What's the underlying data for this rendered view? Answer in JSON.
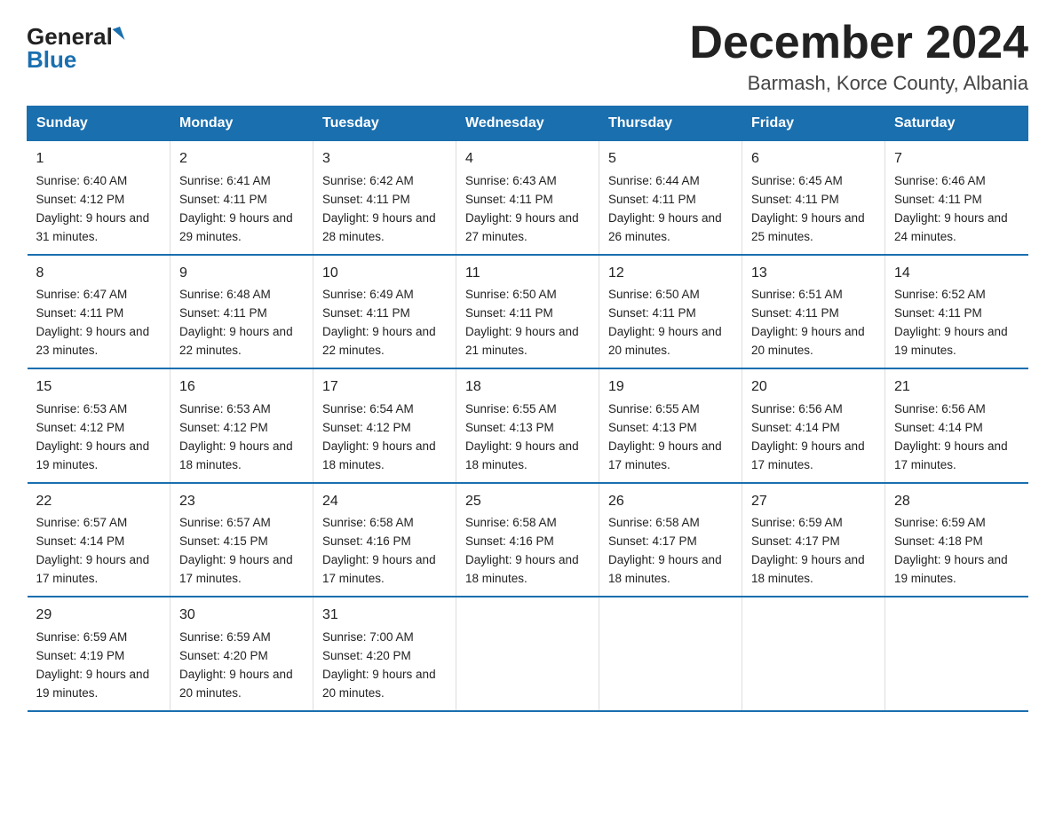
{
  "logo": {
    "general": "General",
    "blue": "Blue"
  },
  "title": "December 2024",
  "subtitle": "Barmash, Korce County, Albania",
  "weekdays": [
    "Sunday",
    "Monday",
    "Tuesday",
    "Wednesday",
    "Thursday",
    "Friday",
    "Saturday"
  ],
  "weeks": [
    [
      {
        "day": "1",
        "sunrise": "6:40 AM",
        "sunset": "4:12 PM",
        "daylight": "9 hours and 31 minutes."
      },
      {
        "day": "2",
        "sunrise": "6:41 AM",
        "sunset": "4:11 PM",
        "daylight": "9 hours and 29 minutes."
      },
      {
        "day": "3",
        "sunrise": "6:42 AM",
        "sunset": "4:11 PM",
        "daylight": "9 hours and 28 minutes."
      },
      {
        "day": "4",
        "sunrise": "6:43 AM",
        "sunset": "4:11 PM",
        "daylight": "9 hours and 27 minutes."
      },
      {
        "day": "5",
        "sunrise": "6:44 AM",
        "sunset": "4:11 PM",
        "daylight": "9 hours and 26 minutes."
      },
      {
        "day": "6",
        "sunrise": "6:45 AM",
        "sunset": "4:11 PM",
        "daylight": "9 hours and 25 minutes."
      },
      {
        "day": "7",
        "sunrise": "6:46 AM",
        "sunset": "4:11 PM",
        "daylight": "9 hours and 24 minutes."
      }
    ],
    [
      {
        "day": "8",
        "sunrise": "6:47 AM",
        "sunset": "4:11 PM",
        "daylight": "9 hours and 23 minutes."
      },
      {
        "day": "9",
        "sunrise": "6:48 AM",
        "sunset": "4:11 PM",
        "daylight": "9 hours and 22 minutes."
      },
      {
        "day": "10",
        "sunrise": "6:49 AM",
        "sunset": "4:11 PM",
        "daylight": "9 hours and 22 minutes."
      },
      {
        "day": "11",
        "sunrise": "6:50 AM",
        "sunset": "4:11 PM",
        "daylight": "9 hours and 21 minutes."
      },
      {
        "day": "12",
        "sunrise": "6:50 AM",
        "sunset": "4:11 PM",
        "daylight": "9 hours and 20 minutes."
      },
      {
        "day": "13",
        "sunrise": "6:51 AM",
        "sunset": "4:11 PM",
        "daylight": "9 hours and 20 minutes."
      },
      {
        "day": "14",
        "sunrise": "6:52 AM",
        "sunset": "4:11 PM",
        "daylight": "9 hours and 19 minutes."
      }
    ],
    [
      {
        "day": "15",
        "sunrise": "6:53 AM",
        "sunset": "4:12 PM",
        "daylight": "9 hours and 19 minutes."
      },
      {
        "day": "16",
        "sunrise": "6:53 AM",
        "sunset": "4:12 PM",
        "daylight": "9 hours and 18 minutes."
      },
      {
        "day": "17",
        "sunrise": "6:54 AM",
        "sunset": "4:12 PM",
        "daylight": "9 hours and 18 minutes."
      },
      {
        "day": "18",
        "sunrise": "6:55 AM",
        "sunset": "4:13 PM",
        "daylight": "9 hours and 18 minutes."
      },
      {
        "day": "19",
        "sunrise": "6:55 AM",
        "sunset": "4:13 PM",
        "daylight": "9 hours and 17 minutes."
      },
      {
        "day": "20",
        "sunrise": "6:56 AM",
        "sunset": "4:14 PM",
        "daylight": "9 hours and 17 minutes."
      },
      {
        "day": "21",
        "sunrise": "6:56 AM",
        "sunset": "4:14 PM",
        "daylight": "9 hours and 17 minutes."
      }
    ],
    [
      {
        "day": "22",
        "sunrise": "6:57 AM",
        "sunset": "4:14 PM",
        "daylight": "9 hours and 17 minutes."
      },
      {
        "day": "23",
        "sunrise": "6:57 AM",
        "sunset": "4:15 PM",
        "daylight": "9 hours and 17 minutes."
      },
      {
        "day": "24",
        "sunrise": "6:58 AM",
        "sunset": "4:16 PM",
        "daylight": "9 hours and 17 minutes."
      },
      {
        "day": "25",
        "sunrise": "6:58 AM",
        "sunset": "4:16 PM",
        "daylight": "9 hours and 18 minutes."
      },
      {
        "day": "26",
        "sunrise": "6:58 AM",
        "sunset": "4:17 PM",
        "daylight": "9 hours and 18 minutes."
      },
      {
        "day": "27",
        "sunrise": "6:59 AM",
        "sunset": "4:17 PM",
        "daylight": "9 hours and 18 minutes."
      },
      {
        "day": "28",
        "sunrise": "6:59 AM",
        "sunset": "4:18 PM",
        "daylight": "9 hours and 19 minutes."
      }
    ],
    [
      {
        "day": "29",
        "sunrise": "6:59 AM",
        "sunset": "4:19 PM",
        "daylight": "9 hours and 19 minutes."
      },
      {
        "day": "30",
        "sunrise": "6:59 AM",
        "sunset": "4:20 PM",
        "daylight": "9 hours and 20 minutes."
      },
      {
        "day": "31",
        "sunrise": "7:00 AM",
        "sunset": "4:20 PM",
        "daylight": "9 hours and 20 minutes."
      },
      null,
      null,
      null,
      null
    ]
  ],
  "labels": {
    "sunrise": "Sunrise:",
    "sunset": "Sunset:",
    "daylight": "Daylight:"
  },
  "colors": {
    "header_bg": "#1a6faf",
    "header_text": "#ffffff",
    "border": "#1a6faf"
  }
}
